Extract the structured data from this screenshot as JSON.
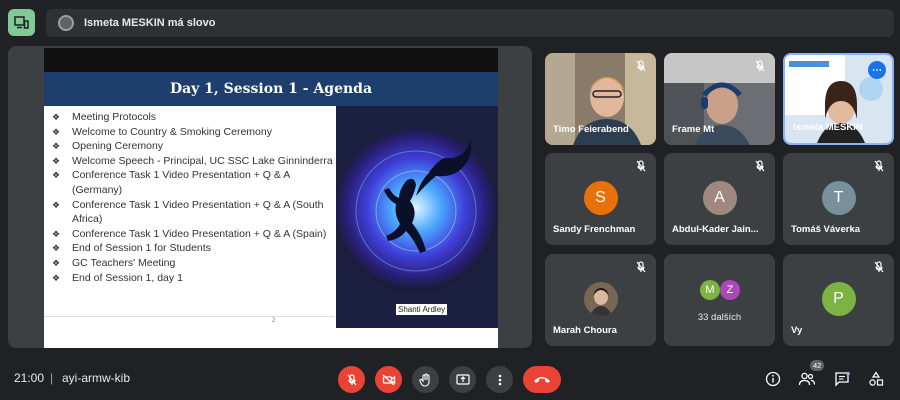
{
  "speaker_bar": {
    "text": "Ismeta MESKIN má slovo"
  },
  "slide": {
    "title": "Day 1, Session 1 - Agenda",
    "items": [
      "Meeting Protocols",
      "Welcome to Country & Smoking Ceremony",
      "Opening Ceremony",
      "Welcome Speech - Principal, UC SSC Lake Ginninderra",
      "Conference Task 1 Video Presentation + Q & A (Germany)",
      "Conference Task 1 Video Presentation + Q & A (South Africa)",
      "Conference Task 1 Video Presentation + Q & A (Spain)",
      "End of Session 1 for Students",
      "GC Teachers' Meeting",
      "End of Session 1, day 1"
    ],
    "bullet": "❖",
    "page_number": "2",
    "art_credit": "Shanti Ardley"
  },
  "participants": [
    {
      "name": "Timo Feierabend",
      "type": "video"
    },
    {
      "name": "Frame Mt",
      "type": "video"
    },
    {
      "name": "Ismeta MESKIN",
      "type": "video",
      "active": true
    },
    {
      "name": "Sandy Frenchman",
      "initial": "S",
      "color": "#e8710a"
    },
    {
      "name": "Abdul-Kader Jain...",
      "initial": "A",
      "color": "#a1887f"
    },
    {
      "name": "Tomáš Váverka",
      "initial": "T",
      "color": "#78909c"
    },
    {
      "name": "Marah Choura",
      "type": "photo"
    },
    {
      "name": "33 dalších",
      "initials": [
        "M",
        "Z"
      ],
      "colors": [
        "#7cb342",
        "#ab47bc"
      ]
    },
    {
      "name": "Vy",
      "initial": "P",
      "color": "#7cb342"
    }
  ],
  "bottom_bar": {
    "time": "21:00",
    "separator": "|",
    "meeting_code": "ayi-armw-kib",
    "participant_count": "42"
  },
  "colors": {
    "background": "#202124",
    "accent": "#8ab4f8",
    "danger": "#ea4335",
    "tile": "#3c4043"
  }
}
